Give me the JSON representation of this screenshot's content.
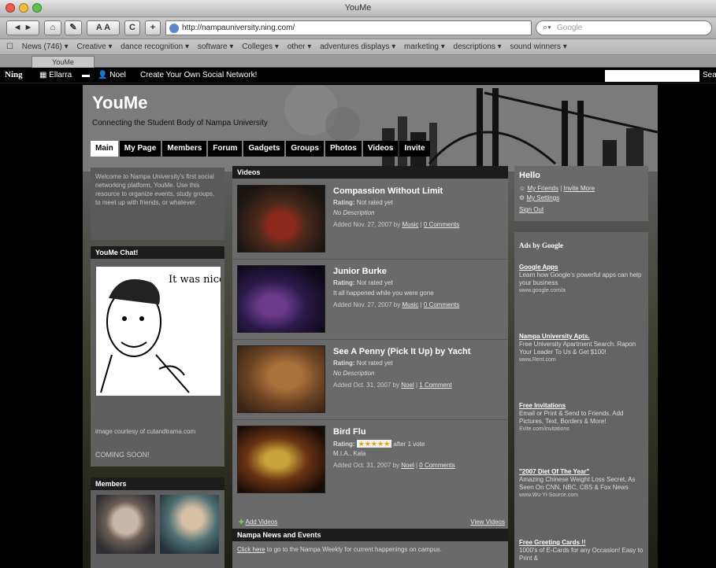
{
  "browser": {
    "window_title": "YouMe",
    "url": "http://nampauniversity.ning.com/",
    "search_placeholder": "Google",
    "nav_buttons": {
      "back": "◄ ►",
      "reload": "C",
      "font": "A A",
      "add": "+"
    },
    "bookmarks": [
      "News (746) ▾",
      "Creative ▾",
      "dance recognition ▾",
      "software ▾",
      "Colleges ▾",
      "other ▾",
      "adventures displays ▾",
      "marketing ▾",
      "descriptions ▾",
      "sound winners ▾"
    ],
    "tab_label": "YouMe",
    "traffic_colors": {
      "close": "#ef5b4d",
      "minimize": "#f4bc3a",
      "zoom": "#5fc04a"
    }
  },
  "ningbar": {
    "logo": "Ning",
    "items": [
      "Ellarra",
      "Noel",
      "Create Your Own Social Network!"
    ],
    "search_label": "Sea"
  },
  "site": {
    "title": "YouMe",
    "tagline": "Connecting the Student Body of Nampa University",
    "nav": [
      "Main",
      "My Page",
      "Members",
      "Forum",
      "Gadgets",
      "Groups",
      "Photos",
      "Videos",
      "Invite"
    ]
  },
  "welcome": {
    "text": "Welcome to Nampa University's first social networking platform, YouMe. Use this resource to organize events, study groups, to meet up with friends, or whatever."
  },
  "chat": {
    "header": "YouMe Chat!",
    "sketch_text": "It was nice talking to you the other night",
    "credit": "image courtesy of cutandtrama.com",
    "coming_soon": "COMING SOON!"
  },
  "members": {
    "header": "Members"
  },
  "videos": {
    "header": "Videos",
    "items": [
      {
        "title": "Compassion Without Limit",
        "rating_label": "Rating:",
        "rating": "Not rated yet",
        "desc": "No Description",
        "added": "Added Nov. 27, 2007 by ",
        "author": "Music",
        "comments": "0 Comments"
      },
      {
        "title": "Junior Burke",
        "rating_label": "Rating:",
        "rating": "Not rated yet",
        "desc": "It all happened while you were gone",
        "added": "Added Nov. 27, 2007 by ",
        "author": "Music",
        "comments": "0 Comments"
      },
      {
        "title": "See A Penny (Pick It Up) by Yacht",
        "rating_label": "Rating:",
        "rating": "Not rated yet",
        "desc": "No Description",
        "added": "Added Oct. 31, 2007 by ",
        "author": "Noel",
        "comments": "1 Comment"
      },
      {
        "title": "Bird Flu",
        "rating_label": "Rating:",
        "rating": "after 1 vote",
        "stars": "★★★★★",
        "desc": "M.I.A., Kala",
        "added": "Added Oct. 31, 2007 by ",
        "author": "Noel",
        "comments": "0 Comments"
      }
    ],
    "add_label": "Add Videos",
    "view_label": "View Videos"
  },
  "news": {
    "header": "Nampa News and Events",
    "link": "Click here",
    "text": " to go to the Nampa Weekly for current happenings on campus."
  },
  "hello": {
    "header": "Hello",
    "links": [
      "My Friends",
      "Invite More",
      "My Settings",
      "Sign Out"
    ]
  },
  "ads": {
    "header": "Ads by Google",
    "items": [
      {
        "title": "Google Apps",
        "body": "Learn how Google's powerful apps can help your business",
        "url": "www.google.com/a"
      },
      {
        "title": "Nampa University Apts.",
        "body": "Free University Apartment Search. Rapon Your Leader To Us & Get $100!",
        "url": "www.Rent.com"
      },
      {
        "title": "Free Invitations",
        "body": "Email or Print & Send to Friends. Add Pictures, Text, Borders & More!",
        "url": "Evite.com/invitations"
      },
      {
        "title": "\"2007 Diet Of The Year\"",
        "body": "Amazing Chinese Weight Loss Secret, As Seen On CNN, NBC, CBS & Fox News",
        "url": "www.Wu-Yi-Source.com"
      },
      {
        "title": "Free Greeting Cards !!",
        "body": "1000's of E-Cards for any Occasion! Easy to Print &",
        "url": ""
      }
    ]
  }
}
